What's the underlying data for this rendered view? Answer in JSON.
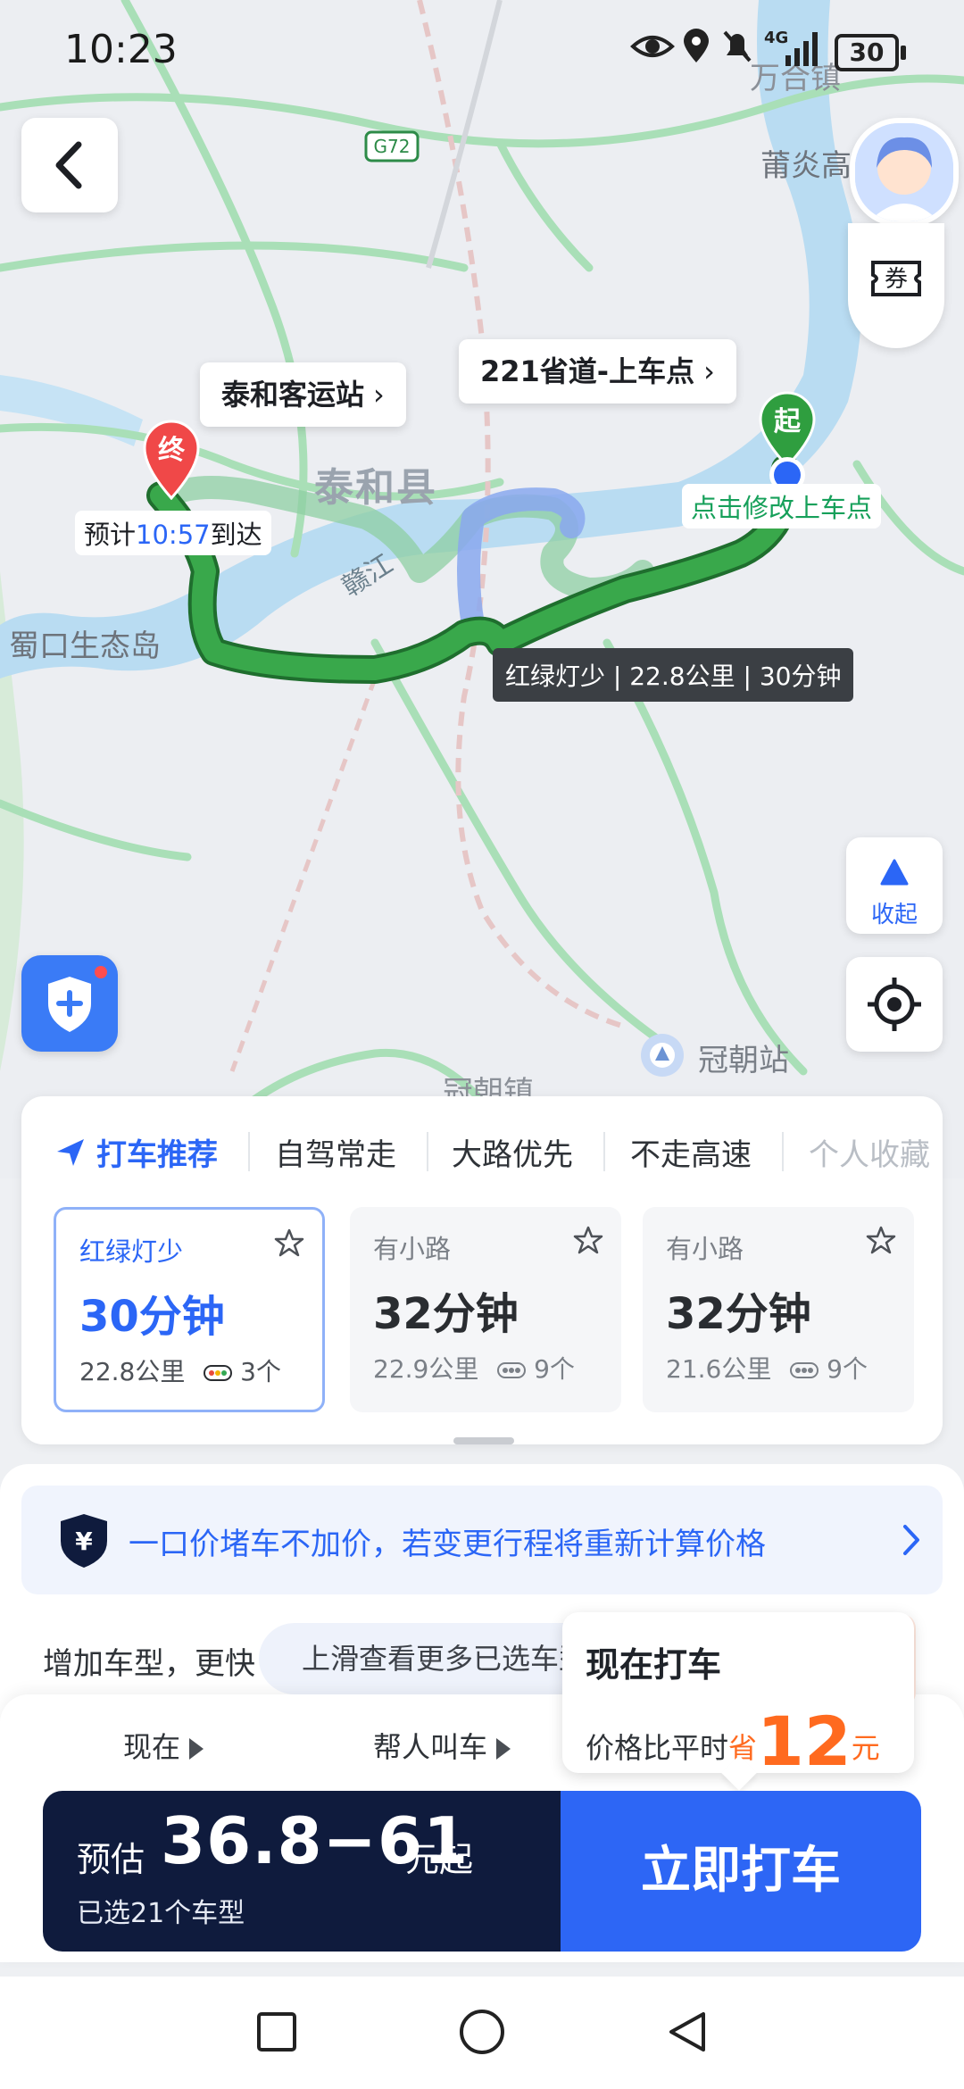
{
  "status_bar": {
    "time": "10:23",
    "battery": "30",
    "network": "4G"
  },
  "map": {
    "places": {
      "town_top_right": "万合镇",
      "town_right": "莆炎高",
      "county": "泰和县",
      "river": "赣江",
      "island": "蜀口生态岛",
      "station": "冠朝站",
      "town_bottom": "冠朝镇",
      "highway": "G72"
    },
    "destination_callout": "泰和客运站",
    "pickup_callout": "221省道-上车点",
    "end_marker": "终",
    "start_marker": "起",
    "eta": {
      "prefix": "预计",
      "time": "10:57",
      "suffix": "到达"
    },
    "pickup_hint": "点击修改上车点",
    "route_info": "红绿灯少 | 22.8公里 | 30分钟",
    "collapse_label": "收起",
    "coupon_label": "券"
  },
  "route_panel": {
    "tabs": [
      {
        "label": "打车推荐",
        "active": true
      },
      {
        "label": "自驾常走",
        "active": false
      },
      {
        "label": "大路优先",
        "active": false
      },
      {
        "label": "不走高速",
        "active": false
      },
      {
        "label": "个人收藏",
        "active": false
      }
    ],
    "options": [
      {
        "tag": "红绿灯少",
        "time": "30分钟",
        "distance": "22.8公里",
        "lights": "3个",
        "selected": true
      },
      {
        "tag": "有小路",
        "time": "32分钟",
        "distance": "22.9公里",
        "lights": "9个",
        "selected": false
      },
      {
        "tag": "有小路",
        "time": "32分钟",
        "distance": "21.6公里",
        "lights": "9个",
        "selected": false
      }
    ]
  },
  "order": {
    "price_banner": "一口价堵车不加价，若变更行程将重新计算价格",
    "price_banner_icon": "¥",
    "add_cartypes": "增加车型，更快",
    "scroll_hint": "上滑查看更多已选车型",
    "time_option": "现在",
    "proxy_option": "帮人叫车",
    "promo": {
      "title": "现在打车",
      "line_prefix": "价格比平时",
      "save_word": "省",
      "amount": "12",
      "unit": "元",
      "badge": "¥"
    },
    "fare": {
      "prefix": "预估",
      "value": "36.8−61",
      "suffix": "元起",
      "selected": "已选21个车型"
    },
    "call_button": "立即打车"
  },
  "colors": {
    "accent": "#2b66f6",
    "route": "#2f9e3f",
    "fare_bg": "#0f1b3d",
    "promo": "#ff6a1f",
    "end_marker": "#f04848",
    "start_marker": "#2f9e3f"
  }
}
